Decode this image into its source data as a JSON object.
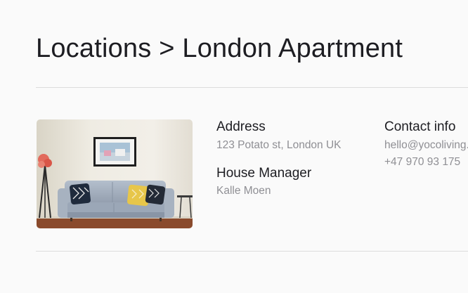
{
  "page": {
    "title": "Locations > London Apartment"
  },
  "location": {
    "photo_alt": "living-room-photo",
    "address_label": "Address",
    "address_value": "123 Potato st, London UK",
    "manager_label": "House Manager",
    "manager_value": "Kalle Moen",
    "contact_label": "Contact info",
    "contact_email": "hello@yocoliving.com",
    "contact_phone": "+47 970 93 175"
  },
  "colors": {
    "background": "#fafafa",
    "text_primary": "#1d1d22",
    "text_secondary": "#8f8f94",
    "divider": "#dcdcdc"
  }
}
